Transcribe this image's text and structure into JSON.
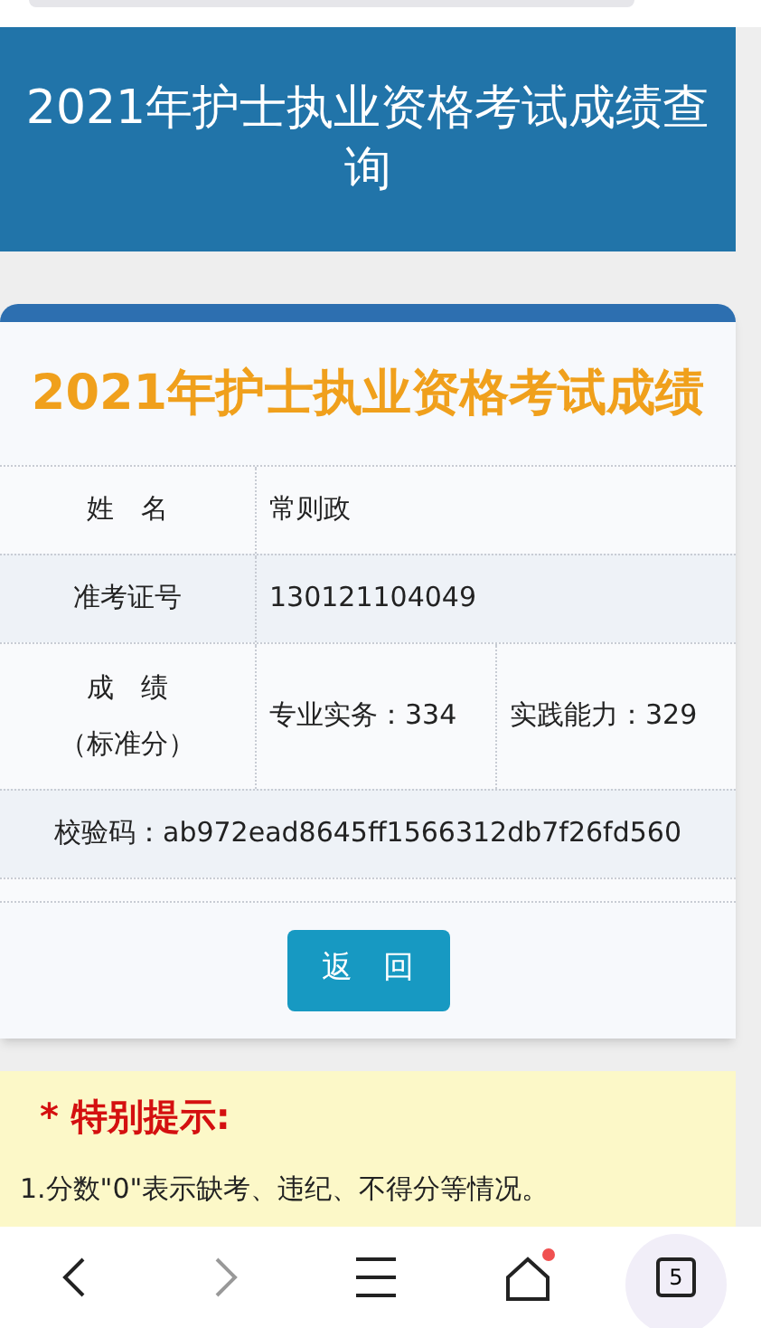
{
  "header": {
    "title": "2021年护士执业资格考试成绩查询"
  },
  "result_card": {
    "title": "2021年护士执业资格考试成绩",
    "rows": [
      {
        "kind": "pair",
        "label": "姓　名",
        "value": "常则政"
      },
      {
        "kind": "pair",
        "label": "准考证号",
        "value": "130121104049"
      },
      {
        "kind": "scores",
        "label_lines": [
          "成　绩",
          "（标准分）"
        ],
        "scores": [
          "专业实务：334",
          "实践能力：329"
        ]
      },
      {
        "kind": "full",
        "value": "校验码：ab972ead8645ff1566312db7f26fd560"
      },
      {
        "kind": "empty"
      }
    ],
    "button": "返　回"
  },
  "notice": {
    "heading": "* 特别提示:",
    "items": [
      "1.分数\"0\"表示缺考、违纪、不得分等情况。"
    ]
  },
  "bottom_nav": {
    "home_badge": true,
    "tab_count": "5"
  }
}
